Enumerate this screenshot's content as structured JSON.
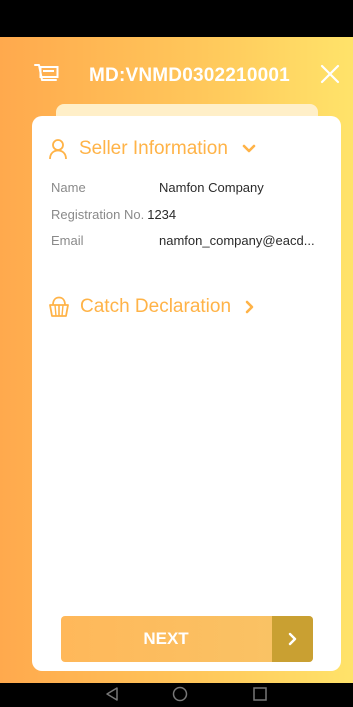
{
  "header": {
    "title": "MD:VNMD0302210001",
    "cart_icon": "cart-icon",
    "close_icon": "close-icon"
  },
  "seller_section": {
    "title": "Seller Information",
    "icon": "person-icon",
    "expanded": true,
    "fields": [
      {
        "label": "Name",
        "value": "Namfon Company"
      },
      {
        "label": "Registration No.",
        "value": "1234"
      },
      {
        "label": "Email",
        "value": "namfon_company@eacd..."
      }
    ]
  },
  "catch_section": {
    "title": "Catch Declaration",
    "icon": "basket-icon",
    "expanded": false
  },
  "footer": {
    "next_label": "NEXT"
  },
  "colors": {
    "accent": "#FFB347",
    "gradient_start": "#FFA94D",
    "gradient_end": "#FFE36A",
    "next_arrow_bg": "#C9A032"
  }
}
